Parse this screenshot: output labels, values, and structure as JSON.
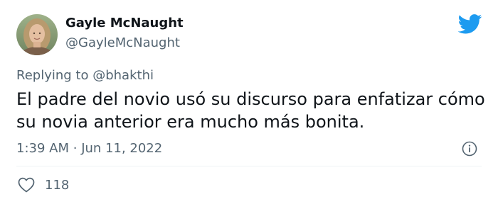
{
  "author": {
    "name": "Gayle McNaught",
    "handle": "@GayleMcNaught",
    "avatar_icon": "profile-photo"
  },
  "platform_icon": "twitter-bird-icon",
  "brand_color": "#1d9bf0",
  "reply": {
    "prefix": "Replying to",
    "mention": "@bhakthi"
  },
  "tweet": {
    "text": "El padre del novio usó su discurso para enfatizar cómo su novia anterior era mucho más bonita.",
    "time": "1:39 AM",
    "separator": "·",
    "date": "Jun 11, 2022"
  },
  "engagement": {
    "likes_icon": "heart-icon",
    "likes": "118",
    "info_icon": "info-icon"
  }
}
